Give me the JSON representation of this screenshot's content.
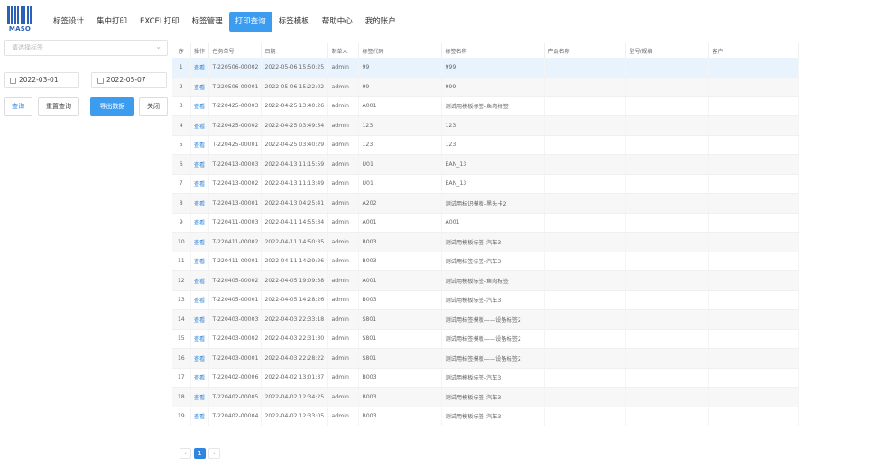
{
  "logo": {
    "text": "MASO"
  },
  "nav": [
    {
      "label": "标签设计",
      "active": false
    },
    {
      "label": "集中打印",
      "active": false
    },
    {
      "label": "EXCEL打印",
      "active": false
    },
    {
      "label": "标签管理",
      "active": false
    },
    {
      "label": "打印查询",
      "active": true
    },
    {
      "label": "标签模板",
      "active": false
    },
    {
      "label": "帮助中心",
      "active": false
    },
    {
      "label": "我的账户",
      "active": false
    }
  ],
  "sidebar": {
    "select_placeholder": "请选择标签",
    "date_from": "2022-03-01",
    "date_to": "2022-05-07",
    "buttons": {
      "query": "查询",
      "requery": "重置查询",
      "export": "导出数据",
      "close": "关闭"
    }
  },
  "table": {
    "headers": [
      "序",
      "操作",
      "任务单号",
      "日期",
      "制单人",
      "标签代码",
      "标签名称",
      "产品名称",
      "型号/规格",
      "客户"
    ],
    "rows": [
      [
        "1",
        "查看",
        "T-220506-00002",
        "2022-05-06 15:50:25",
        "admin",
        "99",
        "999",
        "",
        "",
        ""
      ],
      [
        "2",
        "查看",
        "T-220506-00001",
        "2022-05-06 15:22:02",
        "admin",
        "99",
        "999",
        "",
        "",
        ""
      ],
      [
        "3",
        "查看",
        "T-220425-00003",
        "2022-04-25 13:40:26",
        "admin",
        "A001",
        "测试用模板标签-鱼肉标签",
        "",
        "",
        ""
      ],
      [
        "4",
        "查看",
        "T-220425-00002",
        "2022-04-25 03:49:54",
        "admin",
        "123",
        "123",
        "",
        "",
        ""
      ],
      [
        "5",
        "查看",
        "T-220425-00001",
        "2022-04-25 03:40:29",
        "admin",
        "123",
        "123",
        "",
        "",
        ""
      ],
      [
        "6",
        "查看",
        "T-220413-00003",
        "2022-04-13 11:15:59",
        "admin",
        "U01",
        "EAN_13",
        "",
        "",
        ""
      ],
      [
        "7",
        "查看",
        "T-220413-00002",
        "2022-04-13 11:13:49",
        "admin",
        "U01",
        "EAN_13",
        "",
        "",
        ""
      ],
      [
        "8",
        "查看",
        "T-220413-00001",
        "2022-04-13 04:25:41",
        "admin",
        "A202",
        "测试用标识模板-黑头卡2",
        "",
        "",
        ""
      ],
      [
        "9",
        "查看",
        "T-220411-00003",
        "2022-04-11 14:55:34",
        "admin",
        "A001",
        "A001",
        "",
        "",
        ""
      ],
      [
        "10",
        "查看",
        "T-220411-00002",
        "2022-04-11 14:50:35",
        "admin",
        "B003",
        "测试用模板标签-汽车3",
        "",
        "",
        ""
      ],
      [
        "11",
        "查看",
        "T-220411-00001",
        "2022-04-11 14:29:26",
        "admin",
        "B003",
        "测试用标签标签-汽车3",
        "",
        "",
        ""
      ],
      [
        "12",
        "查看",
        "T-220405-00002",
        "2022-04-05 19:09:38",
        "admin",
        "A001",
        "测试用模板标签-鱼肉标签",
        "",
        "",
        ""
      ],
      [
        "13",
        "查看",
        "T-220405-00001",
        "2022-04-05 14:28:26",
        "admin",
        "B003",
        "测试用模板标签-汽车3",
        "",
        "",
        ""
      ],
      [
        "14",
        "查看",
        "T-220403-00003",
        "2022-04-03 22:33:18",
        "admin",
        "S801",
        "测试用标签模板——设备标签2",
        "",
        "",
        ""
      ],
      [
        "15",
        "查看",
        "T-220403-00002",
        "2022-04-03 22:31:30",
        "admin",
        "S801",
        "测试用标签模板——设备标签2",
        "",
        "",
        ""
      ],
      [
        "16",
        "查看",
        "T-220403-00001",
        "2022-04-03 22:28:22",
        "admin",
        "S801",
        "测试用标签模板——设备标签2",
        "",
        "",
        ""
      ],
      [
        "17",
        "查看",
        "T-220402-00006",
        "2022-04-02 13:01:37",
        "admin",
        "B003",
        "测试用模板标签-汽车3",
        "",
        "",
        ""
      ],
      [
        "18",
        "查看",
        "T-220402-00005",
        "2022-04-02 12:34:25",
        "admin",
        "B003",
        "测试用模板标签-汽车3",
        "",
        "",
        ""
      ],
      [
        "19",
        "查看",
        "T-220402-00004",
        "2022-04-02 12:33:05",
        "admin",
        "B003",
        "测试用模板标签-汽车3",
        "",
        "",
        ""
      ]
    ]
  },
  "pagination": {
    "prev": "‹",
    "current": "1",
    "next": "›"
  },
  "colors": {
    "accent": "#3c9df0",
    "link": "#2f86e0",
    "brand": "#2a62b8",
    "selected_row": "#e9f3fd"
  },
  "icons": {
    "select": "chevron-down-icon",
    "date": "calendar-icon"
  }
}
